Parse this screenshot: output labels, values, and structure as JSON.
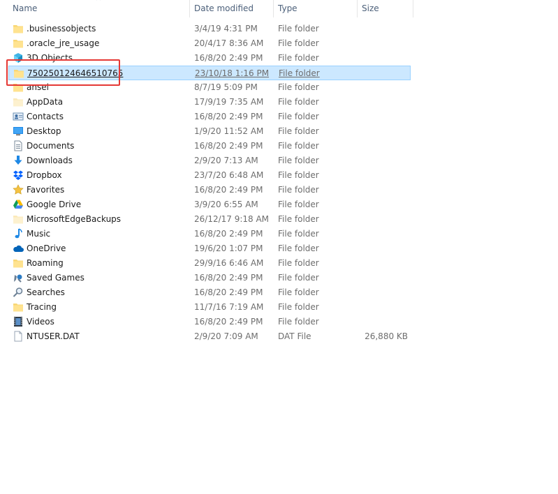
{
  "columns": {
    "name": "Name",
    "date": "Date modified",
    "type": "Type",
    "size": "Size"
  },
  "colors": {
    "selection": "#cce8ff",
    "highlight_box": "#e53935",
    "header_text": "#4c607a"
  },
  "files": [
    {
      "name": ".businessobjects",
      "date": "3/4/19 4:31 PM",
      "type": "File folder",
      "size": "",
      "icon": "folder-icon"
    },
    {
      "name": ".oracle_jre_usage",
      "date": "20/4/17 8:36 AM",
      "type": "File folder",
      "size": "",
      "icon": "folder-icon"
    },
    {
      "name": "3D Objects",
      "date": "16/8/20 2:49 PM",
      "type": "File folder",
      "size": "",
      "icon": "3d-objects-icon"
    },
    {
      "name": "750250124646510765",
      "date": "23/10/18 1:16 PM",
      "type": "File folder",
      "size": "",
      "icon": "folder-icon",
      "selected": true
    },
    {
      "name": "ansel",
      "date": "8/7/19 5:09 PM",
      "type": "File folder",
      "size": "",
      "icon": "folder-icon"
    },
    {
      "name": "AppData",
      "date": "17/9/19 7:35 AM",
      "type": "File folder",
      "size": "",
      "icon": "folder-hidden-icon"
    },
    {
      "name": "Contacts",
      "date": "16/8/20 2:49 PM",
      "type": "File folder",
      "size": "",
      "icon": "contacts-icon"
    },
    {
      "name": "Desktop",
      "date": "1/9/20 11:52 AM",
      "type": "File folder",
      "size": "",
      "icon": "desktop-icon"
    },
    {
      "name": "Documents",
      "date": "16/8/20 2:49 PM",
      "type": "File folder",
      "size": "",
      "icon": "documents-icon"
    },
    {
      "name": "Downloads",
      "date": "2/9/20 7:13 AM",
      "type": "File folder",
      "size": "",
      "icon": "downloads-icon"
    },
    {
      "name": "Dropbox",
      "date": "23/7/20 6:48 AM",
      "type": "File folder",
      "size": "",
      "icon": "dropbox-icon"
    },
    {
      "name": "Favorites",
      "date": "16/8/20 2:49 PM",
      "type": "File folder",
      "size": "",
      "icon": "favorites-icon"
    },
    {
      "name": "Google Drive",
      "date": "3/9/20 6:55 AM",
      "type": "File folder",
      "size": "",
      "icon": "google-drive-icon"
    },
    {
      "name": "MicrosoftEdgeBackups",
      "date": "26/12/17 9:18 AM",
      "type": "File folder",
      "size": "",
      "icon": "folder-hidden-icon"
    },
    {
      "name": "Music",
      "date": "16/8/20 2:49 PM",
      "type": "File folder",
      "size": "",
      "icon": "music-icon"
    },
    {
      "name": "OneDrive",
      "date": "19/6/20 1:07 PM",
      "type": "File folder",
      "size": "",
      "icon": "onedrive-icon"
    },
    {
      "name": "Roaming",
      "date": "29/9/16 6:46 AM",
      "type": "File folder",
      "size": "",
      "icon": "folder-icon"
    },
    {
      "name": "Saved Games",
      "date": "16/8/20 2:49 PM",
      "type": "File folder",
      "size": "",
      "icon": "saved-games-icon"
    },
    {
      "name": "Searches",
      "date": "16/8/20 2:49 PM",
      "type": "File folder",
      "size": "",
      "icon": "searches-icon"
    },
    {
      "name": "Tracing",
      "date": "11/7/16 7:19 AM",
      "type": "File folder",
      "size": "",
      "icon": "folder-icon"
    },
    {
      "name": "Videos",
      "date": "16/8/20 2:49 PM",
      "type": "File folder",
      "size": "",
      "icon": "videos-icon"
    },
    {
      "name": "NTUSER.DAT",
      "date": "2/9/20 7:09 AM",
      "type": "DAT File",
      "size": "26,880 KB",
      "icon": "file-icon"
    }
  ]
}
